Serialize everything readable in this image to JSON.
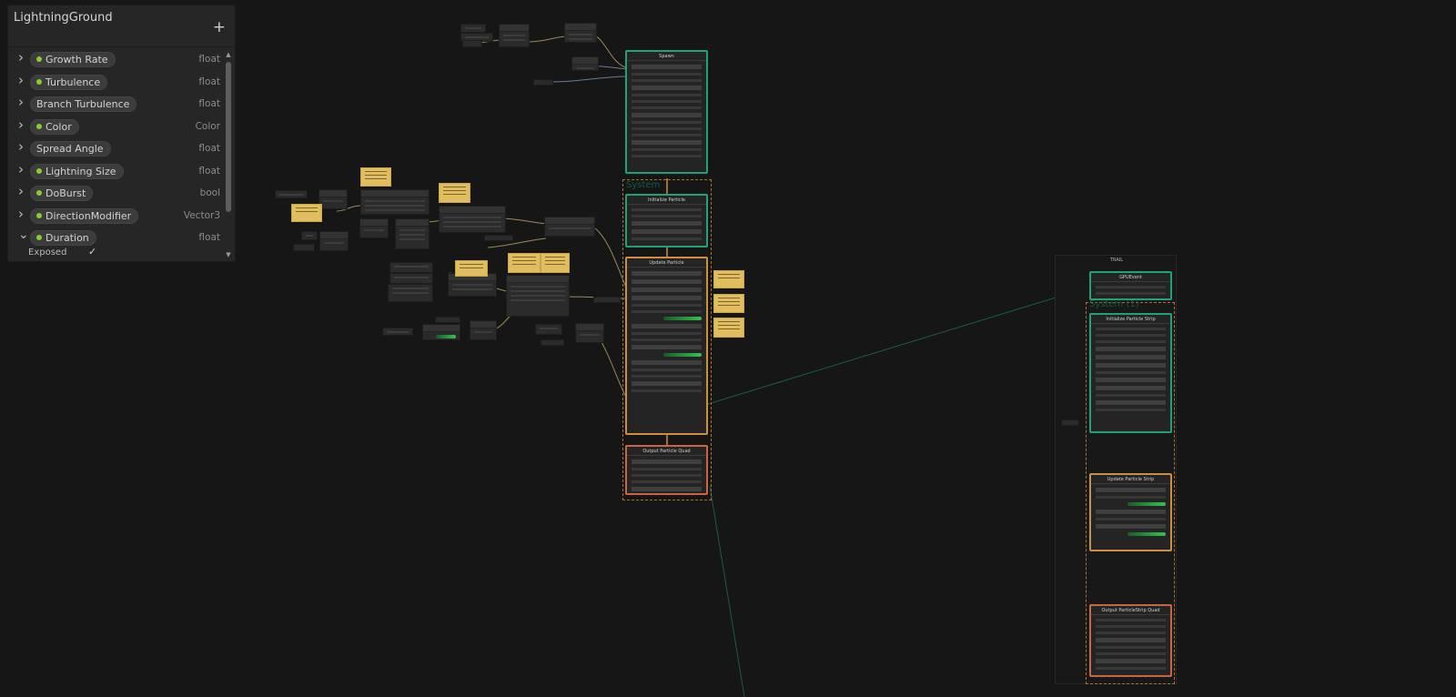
{
  "blackboard": {
    "title": "LightningGround",
    "add_icon": "+",
    "properties": [
      {
        "name": "Growth Rate",
        "type": "float",
        "exposed_dot": true,
        "expanded": false
      },
      {
        "name": "Turbulence",
        "type": "float",
        "exposed_dot": true,
        "expanded": false
      },
      {
        "name": "Branch Turbulence",
        "type": "float",
        "exposed_dot": false,
        "expanded": false
      },
      {
        "name": "Color",
        "type": "Color",
        "exposed_dot": true,
        "expanded": false
      },
      {
        "name": "Spread Angle",
        "type": "float",
        "exposed_dot": false,
        "expanded": false
      },
      {
        "name": "Lightning Size",
        "type": "float",
        "exposed_dot": true,
        "expanded": false
      },
      {
        "name": "DoBurst",
        "type": "bool",
        "exposed_dot": true,
        "expanded": false
      },
      {
        "name": "DirectionModifier",
        "type": "Vector3",
        "exposed_dot": true,
        "expanded": false
      },
      {
        "name": "Duration",
        "type": "float",
        "exposed_dot": true,
        "expanded": true
      }
    ],
    "exposed_label": "Exposed",
    "exposed_checked": true,
    "check_icon": "checkmark-icon"
  },
  "graph": {
    "system_label": "System",
    "system2_label": "System (1)",
    "trail_label": "TRAIL",
    "contexts": {
      "spawn": "Spawn",
      "init": "Initialize Particle",
      "update": "Update Particle",
      "output": "Output Particle Quad",
      "gpu_event": "GPUEvent",
      "init2": "Initialize Particle Strip",
      "update2": "Update Particle Strip",
      "output2": "Output ParticleStrip Quad"
    },
    "colors": {
      "spawn_border": "#1ea377",
      "init_border": "#1ea377",
      "update_border": "#c98f43",
      "output_border": "#c96540",
      "curve": "#35c44d",
      "sticky": "#e0bd5e",
      "exposed_dot": "#8acb32"
    }
  }
}
